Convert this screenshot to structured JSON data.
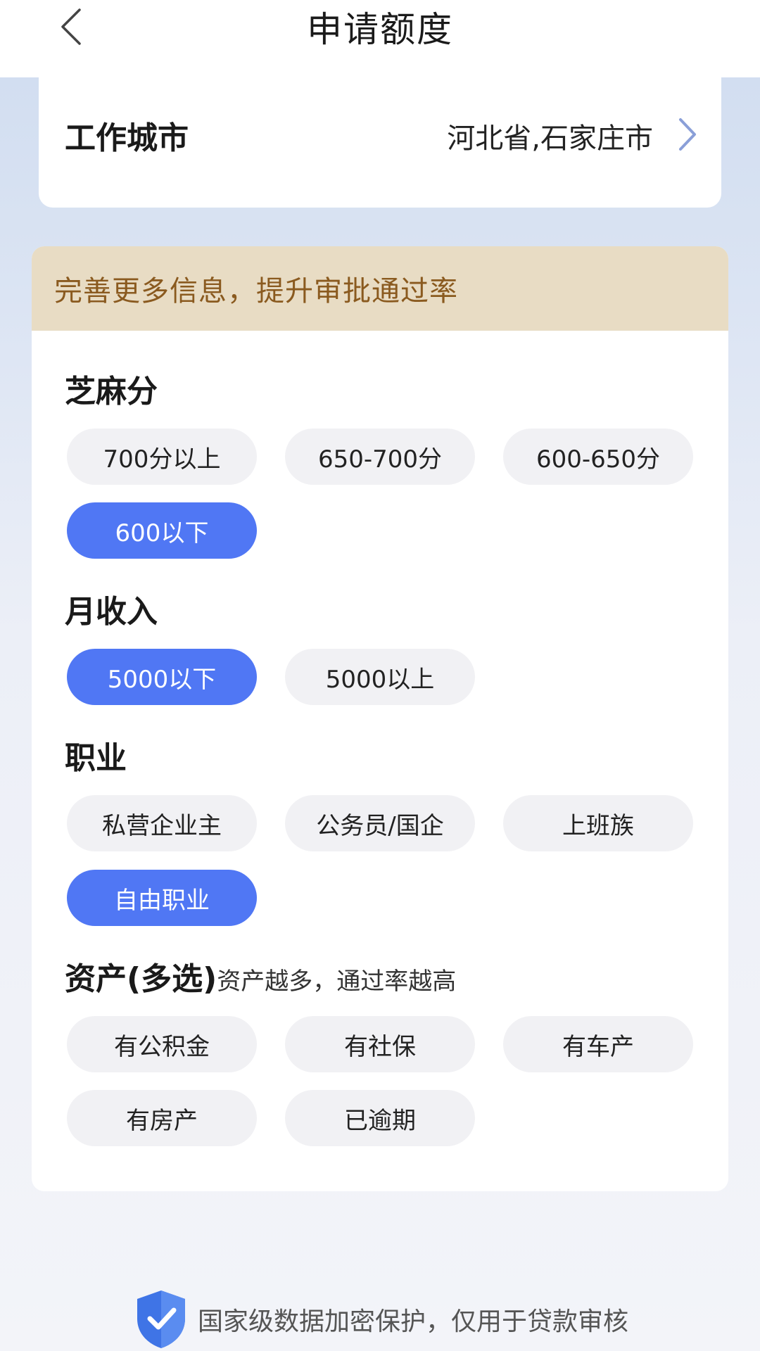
{
  "header": {
    "title": "申请额度",
    "back_icon": "chevron-left-icon"
  },
  "city": {
    "label": "工作城市",
    "value": "河北省,石家庄市",
    "chevron_icon": "chevron-right-icon"
  },
  "banner": {
    "text": "完善更多信息，提升审批通过率"
  },
  "sections": {
    "sesame": {
      "title": "芝麻分",
      "options": [
        "700分以上",
        "650-700分",
        "600-650分",
        "600以下"
      ],
      "selected": "600以下"
    },
    "income": {
      "title": "月收入",
      "options": [
        "5000以下",
        "5000以上"
      ],
      "selected": "5000以下"
    },
    "job": {
      "title": "职业",
      "options": [
        "私营企业主",
        "公务员/国企",
        "上班族",
        "自由职业"
      ],
      "selected": "自由职业"
    },
    "assets": {
      "title": "资产(多选)",
      "subtitle": "资产越多，通过率越高",
      "options": [
        "有公积金",
        "有社保",
        "有车产",
        "有房产",
        "已逾期"
      ],
      "selected": []
    }
  },
  "footer": {
    "text": "国家级数据加密保护，仅用于贷款审核",
    "icon": "shield-check-icon"
  },
  "colors": {
    "accent": "#5077f4",
    "banner_bg": "#e8dcc4",
    "banner_text": "#8a5a1f"
  }
}
